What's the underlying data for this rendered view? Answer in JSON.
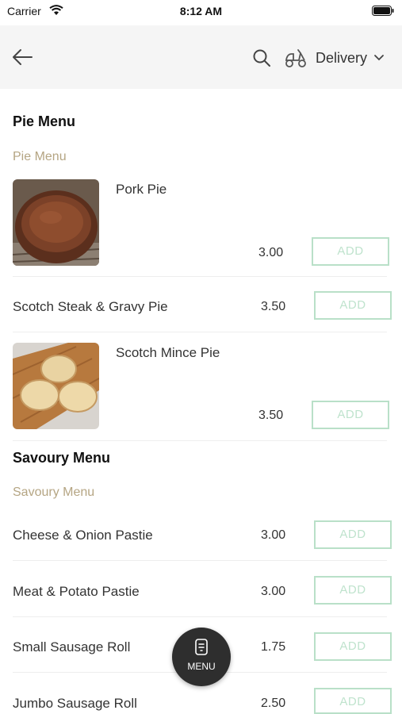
{
  "status_bar": {
    "carrier": "Carrier",
    "time": "8:12 AM"
  },
  "header": {
    "delivery_label": "Delivery"
  },
  "sections": [
    {
      "title": "Pie Menu",
      "subtitle": "Pie Menu"
    },
    {
      "title": "Savoury Menu",
      "subtitle": "Savoury Menu"
    }
  ],
  "items": [
    {
      "name": "Pork Pie",
      "price": "3.00",
      "button": "ADD"
    },
    {
      "name": "Scotch Steak & Gravy Pie",
      "price": "3.50",
      "button": "ADD"
    },
    {
      "name": "Scotch Mince Pie",
      "price": "3.50",
      "button": "ADD"
    },
    {
      "name": "Cheese & Onion Pastie",
      "price": "3.00",
      "button": "ADD"
    },
    {
      "name": "Meat & Potato Pastie",
      "price": "3.00",
      "button": "ADD"
    },
    {
      "name": "Small Sausage Roll",
      "price": "1.75",
      "button": "ADD"
    },
    {
      "name": "Jumbo Sausage Roll",
      "price": "2.50",
      "button": "ADD"
    }
  ],
  "fab": {
    "label": "MENU"
  },
  "colors": {
    "accent_subtitle": "#b5a583",
    "add_border": "#b9e0c8",
    "header_bg": "#f5f5f5",
    "fab_bg": "#2e2e2e"
  }
}
